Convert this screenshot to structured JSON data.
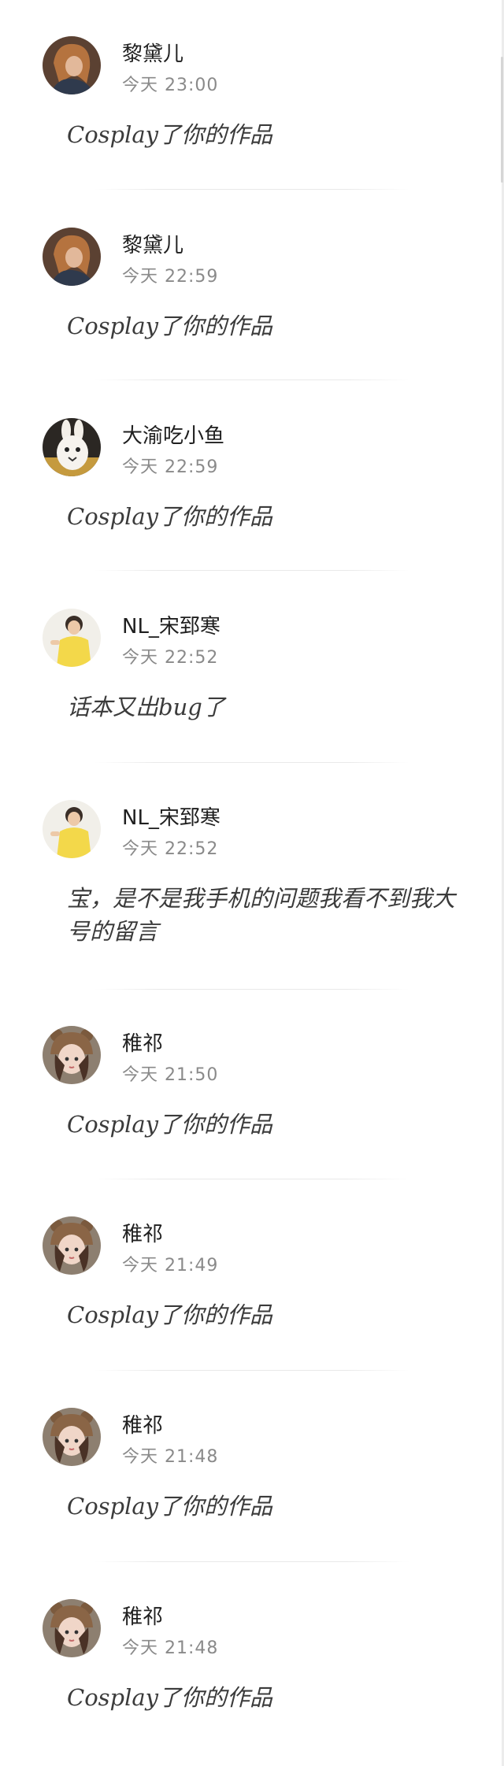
{
  "comments": [
    {
      "name": "黎黛儿",
      "time": "今天 23:00",
      "text": "Cosplay了你的作品",
      "avatar": "avatar-girl-brown-hair"
    },
    {
      "name": "黎黛儿",
      "time": "今天 22:59",
      "text": "Cosplay了你的作品",
      "avatar": "avatar-girl-brown-hair"
    },
    {
      "name": "大渝吃小鱼",
      "time": "今天 22:59",
      "text": "Cosplay了你的作品",
      "avatar": "avatar-rabbit"
    },
    {
      "name": "NL_宋郅寒",
      "time": "今天 22:52",
      "text": "话本又出bug了",
      "avatar": "avatar-boy-yellow-shirt"
    },
    {
      "name": "NL_宋郅寒",
      "time": "今天 22:52",
      "text": "宝，是不是我手机的问题我看不到我大号的留言",
      "avatar": "avatar-boy-yellow-shirt"
    },
    {
      "name": "稚祁",
      "time": "今天 21:50",
      "text": "Cosplay了你的作品",
      "avatar": "avatar-girl-bear-hat"
    },
    {
      "name": "稚祁",
      "time": "今天 21:49",
      "text": "Cosplay了你的作品",
      "avatar": "avatar-girl-bear-hat"
    },
    {
      "name": "稚祁",
      "time": "今天 21:48",
      "text": "Cosplay了你的作品",
      "avatar": "avatar-girl-bear-hat"
    },
    {
      "name": "稚祁",
      "time": "今天 21:48",
      "text": "Cosplay了你的作品",
      "avatar": "avatar-girl-bear-hat"
    }
  ]
}
